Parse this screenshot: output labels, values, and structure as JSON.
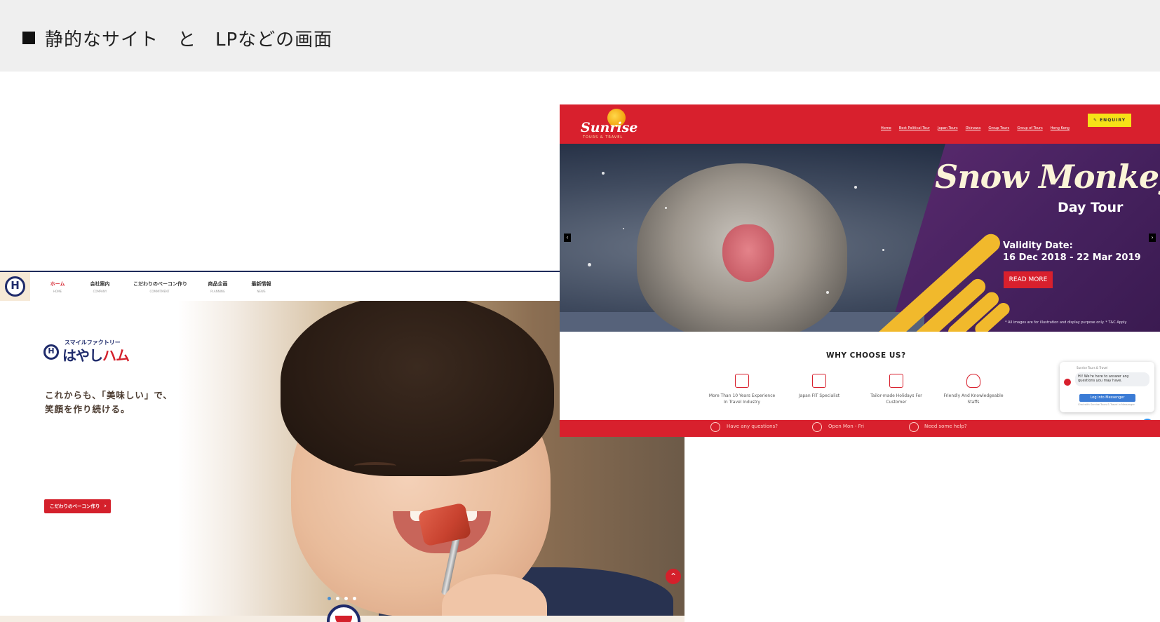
{
  "header": {
    "title": "静的なサイト　と　LPなどの画面"
  },
  "ham": {
    "logo_letter": "H",
    "nav": [
      {
        "label": "ホーム",
        "sub": "HOME"
      },
      {
        "label": "会社案内",
        "sub": "COMPANY"
      },
      {
        "label": "こだわりのベーコン作り",
        "sub": "COMMITMENT"
      },
      {
        "label": "商品企画",
        "sub": "PLANNING"
      },
      {
        "label": "最新情報",
        "sub": "NEWS"
      }
    ],
    "brand_small": "スマイルファクトリー",
    "brand_name_a": "はやし",
    "brand_name_b": "ハム",
    "tagline_1": "これからも、「美味しい」で、",
    "tagline_2": "笑顔を作り続ける。",
    "cta": "こだわりのベーコン作り",
    "slides": 4,
    "active_slide": 1
  },
  "sun": {
    "logo_word": "Sunrise",
    "logo_sub": "TOURS & TRAVEL",
    "nav_links": [
      "Home",
      "Best Political Tour",
      "Japan Tours",
      "Okinawa",
      "Group Tours",
      "Group of Tours",
      "Hong Kong"
    ],
    "enquiry": "ENQUIRY",
    "hero_title": "Snow Monkey",
    "hero_sub": "Day Tour",
    "validity_1": "Validity Date:",
    "validity_2": "16 Dec 2018 - 22 Mar 2019",
    "read_more": "READ MORE",
    "disclaimer": "* All images are for illustration and display purpose only. * T&C Apply",
    "why": "WHY CHOOSE US?",
    "features": [
      {
        "text": "More Than 10 Years Experience In Travel Industry"
      },
      {
        "text": "Japan FIT Specialist"
      },
      {
        "text": "Tailor-made Holidays For Customer"
      },
      {
        "text": "Friendly And Knowledgeable Staffs"
      }
    ],
    "chat": {
      "from": "Sunrise Tours & Travel",
      "message": "Hi! We're here to answer any questions you may have.",
      "button": "Log into Messenger",
      "small": "Chat with Sunrise Tours & Travel in Messenger"
    },
    "footer": [
      {
        "text": "Have any questions?"
      },
      {
        "text": "Open Mon - Fri"
      },
      {
        "text": "Need some help?"
      }
    ],
    "colors": {
      "brand_red": "#d8202d",
      "accent_yellow": "#f1b92c",
      "purple": "#472260"
    }
  }
}
